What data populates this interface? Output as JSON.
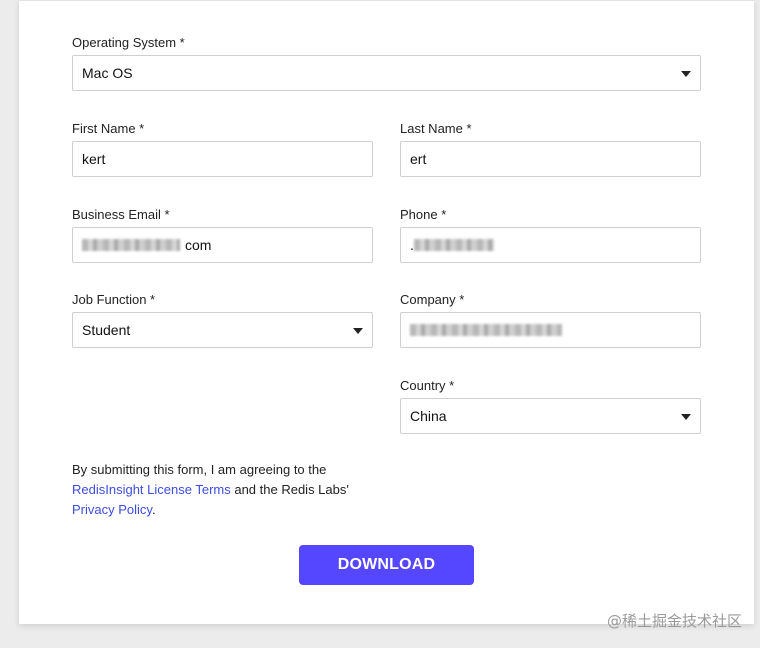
{
  "form": {
    "os": {
      "label": "Operating System *",
      "value": "Mac OS"
    },
    "first_name": {
      "label": "First Name *",
      "value": "kert"
    },
    "last_name": {
      "label": "Last Name *",
      "value": "ert"
    },
    "email": {
      "label": "Business Email *",
      "value_suffix": "com"
    },
    "phone": {
      "label": "Phone *",
      "value_prefix": "."
    },
    "job_function": {
      "label": "Job Function *",
      "value": "Student"
    },
    "company": {
      "label": "Company *"
    },
    "country": {
      "label": "Country *",
      "value": "China"
    }
  },
  "consent": {
    "text_1": "By submitting this form, I am agreeing to the",
    "license_link": "RedisInsight License Terms",
    "text_2": " and the Redis Labs' ",
    "privacy_link": "Privacy Policy",
    "text_3": "."
  },
  "download_label": "DOWNLOAD",
  "watermark": "@稀土掘金技术社区",
  "colors": {
    "primary": "#5546ff",
    "link": "#3d4de0"
  },
  "icons": {
    "select_caret": "chevron-down-icon"
  }
}
